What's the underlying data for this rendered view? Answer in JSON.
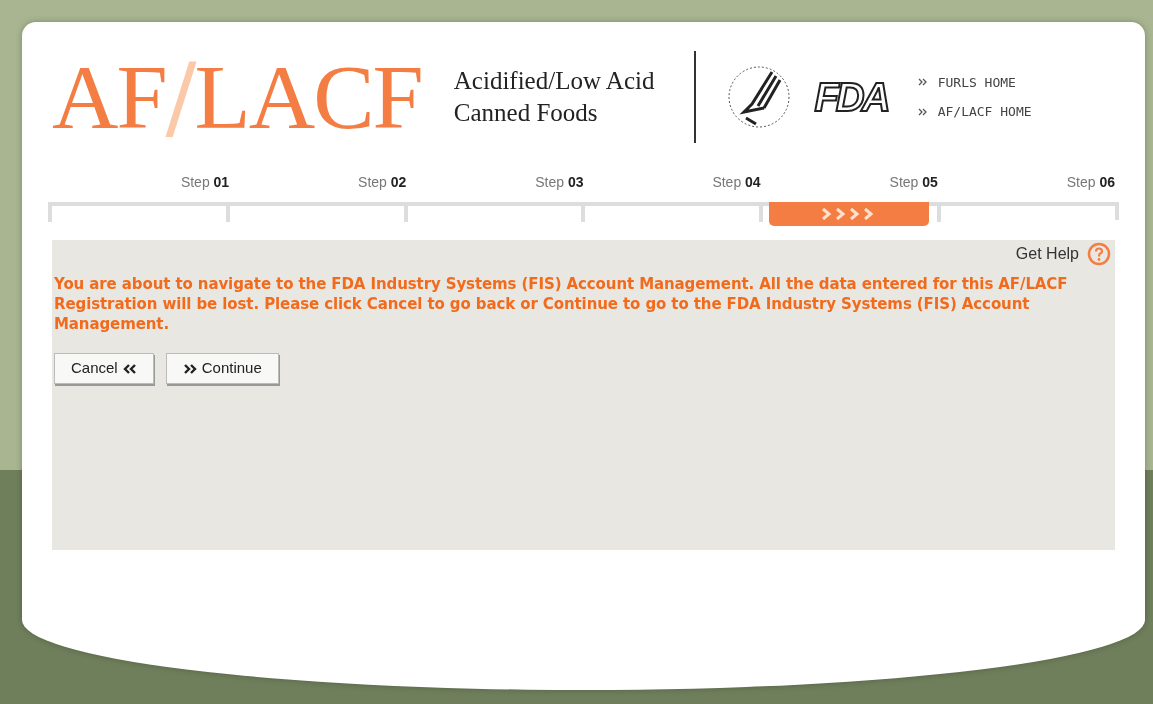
{
  "header": {
    "logo": {
      "left": "AF",
      "slash": "/",
      "right": "LACF"
    },
    "subtitle_lines": [
      "Acidified/Low Acid",
      "Canned Foods"
    ],
    "agency_mark": "FDA",
    "links": [
      {
        "label": "FURLS HOME"
      },
      {
        "label": "AF/LACF HOME"
      }
    ]
  },
  "steps": [
    {
      "word": "Step",
      "number": "01",
      "selected": false
    },
    {
      "word": "Step",
      "number": "02",
      "selected": false
    },
    {
      "word": "Step",
      "number": "03",
      "selected": false
    },
    {
      "word": "Step",
      "number": "04",
      "selected": false
    },
    {
      "word": "Step",
      "number": "05",
      "selected": true
    },
    {
      "word": "Step",
      "number": "06",
      "selected": false
    }
  ],
  "help": {
    "label": "Get Help"
  },
  "message": "You are about to navigate to the FDA Industry Systems (FIS) Account Management. All the data entered for this AF/LACF Registration will be lost. Please click Cancel to go back or Continue to go to the FDA Industry Systems (FIS) Account Management.",
  "buttons": [
    {
      "kind": "back",
      "label": "Cancel"
    },
    {
      "kind": "forward",
      "label": "Continue"
    }
  ]
}
